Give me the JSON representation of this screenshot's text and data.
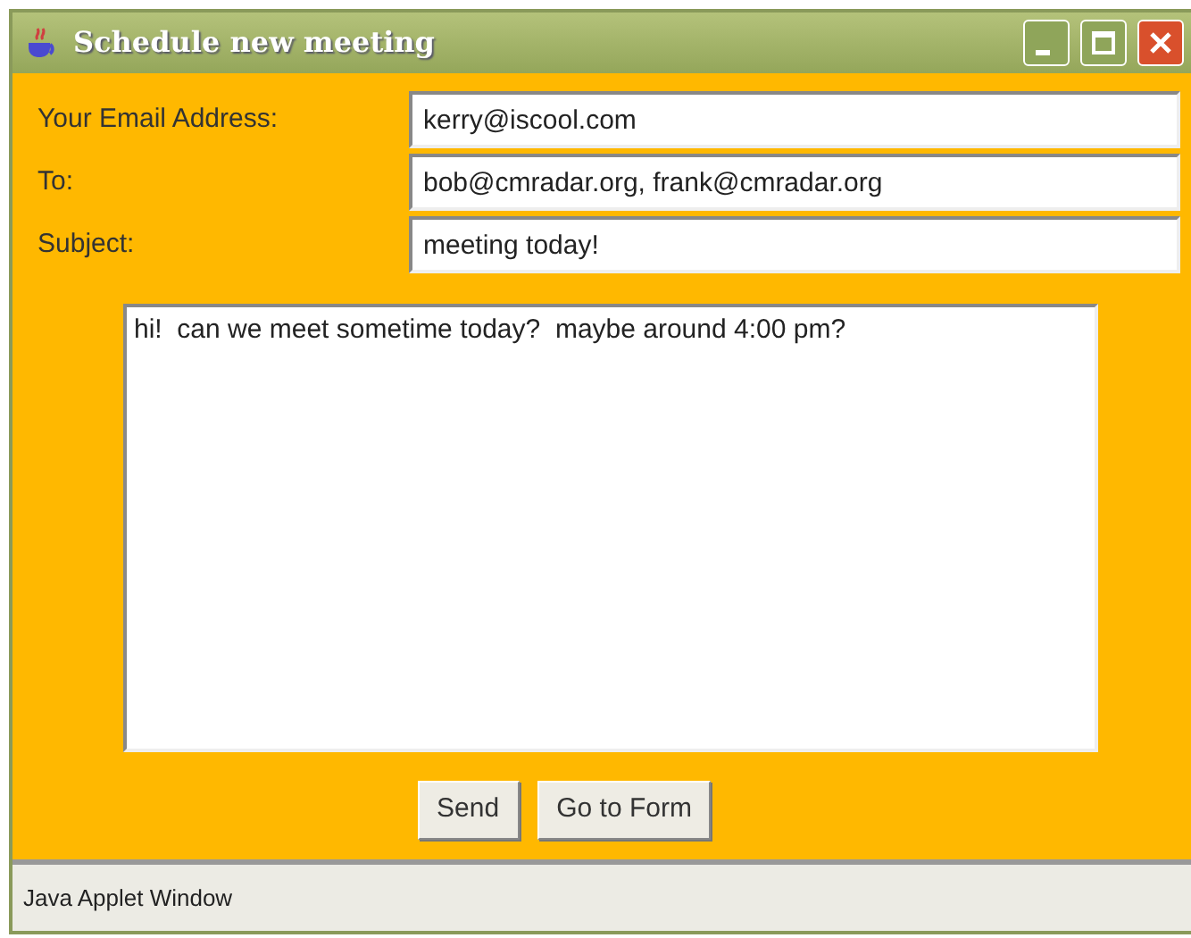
{
  "window": {
    "title": "Schedule new meeting"
  },
  "fields": [
    {
      "label": "Your Email Address:",
      "value": "kerry@iscool.com"
    },
    {
      "label": "To:",
      "value": "bob@cmradar.org, frank@cmradar.org"
    },
    {
      "label": "Subject:",
      "value": "meeting today!"
    }
  ],
  "message": {
    "value": "hi!  can we meet sometime today?  maybe around 4:00 pm?"
  },
  "buttons": [
    "Send",
    "Go to Form"
  ],
  "status_bar": "Java Applet Window"
}
